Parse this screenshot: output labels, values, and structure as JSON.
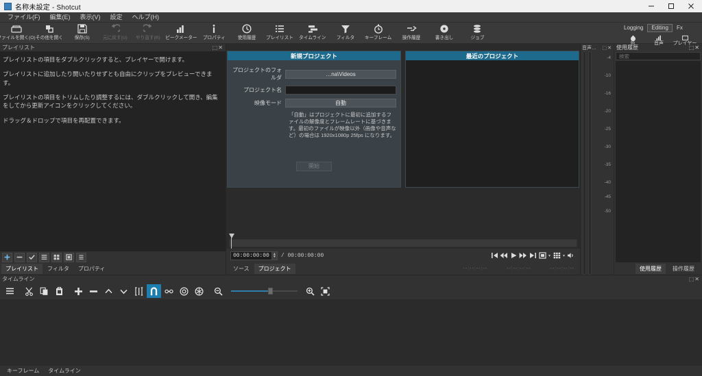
{
  "window": {
    "title": "名称未設定 - Shotcut",
    "minimize": "−",
    "maximize": "▢",
    "close": "✕"
  },
  "menubar": {
    "items": [
      {
        "label": "ファイル(F)"
      },
      {
        "label": "編集(E)"
      },
      {
        "label": "表示(V)"
      },
      {
        "label": "設定"
      },
      {
        "label": "ヘルプ(H)"
      }
    ]
  },
  "toolbar": {
    "items": [
      {
        "label": "ファイルを開く(O)",
        "icon": "open-file-icon",
        "disabled": false
      },
      {
        "label": "その他を開く",
        "icon": "open-other-icon",
        "disabled": false
      },
      {
        "label": "保存(S)",
        "icon": "save-icon",
        "disabled": false
      },
      {
        "label": "元に戻す(U)",
        "icon": "undo-icon",
        "disabled": true
      },
      {
        "label": "やり直す(R)",
        "icon": "redo-icon",
        "disabled": true
      },
      {
        "label": "ピークメーター",
        "icon": "peak-meter-icon",
        "disabled": false
      },
      {
        "label": "プロパティ",
        "icon": "properties-icon",
        "disabled": false
      },
      {
        "label": "使用履歴",
        "icon": "recent-icon",
        "disabled": false
      },
      {
        "label": "プレイリスト",
        "icon": "playlist-icon",
        "disabled": false
      },
      {
        "label": "タイムライン",
        "icon": "timeline-icon",
        "disabled": false
      },
      {
        "label": "フィルタ",
        "icon": "filters-icon",
        "disabled": false
      },
      {
        "label": "キーフレーム",
        "icon": "keyframes-icon",
        "disabled": false
      },
      {
        "label": "操作履歴",
        "icon": "history-icon",
        "disabled": false
      },
      {
        "label": "書き出し",
        "icon": "export-icon",
        "disabled": false
      },
      {
        "label": "ジョブ",
        "icon": "jobs-icon",
        "disabled": false
      }
    ],
    "layouts": {
      "logging": "Logging",
      "editing": "Editing",
      "fx": "Fx",
      "color": "色",
      "audio": "音声",
      "player": "プレイヤー"
    }
  },
  "playlist_panel": {
    "title": "プレイリスト",
    "close_glyph": "⬚✕",
    "hints": [
      "プレイリストの項目をダブルクリックすると、プレイヤーで開けます。",
      "プレイリストに追加したり開いたりせずとも自由にクリップをプレビューできます。",
      "プレイリストの項目をトリムしたり調整するには、ダブルクリックして開き、編集をしてから更新アイコンをクリックしてください。",
      "ドラッグ＆ドロップで項目を再配置できます。"
    ],
    "buttons": [
      {
        "name": "add-to-playlist-button",
        "glyph": "✚"
      },
      {
        "name": "remove-from-playlist-button",
        "glyph": "▬"
      },
      {
        "name": "update-playlist-item-button",
        "glyph": "✔"
      },
      {
        "name": "playlist-detail-view-button",
        "glyph": "☰"
      },
      {
        "name": "playlist-tiles-view-button",
        "glyph": "▦"
      },
      {
        "name": "playlist-icons-view-button",
        "glyph": "▣"
      },
      {
        "name": "playlist-menu-button",
        "glyph": "≡"
      }
    ],
    "tabs": [
      {
        "label": "プレイリスト",
        "active": true
      },
      {
        "label": "フィルタ",
        "active": false
      },
      {
        "label": "プロパティ",
        "active": false
      }
    ]
  },
  "start_page": {
    "new_project": {
      "header": "新規プロジェクト",
      "folder_label": "プロジェクトのフォルダ",
      "folder_value": "…na\\Videos",
      "name_label": "プロジェクト名",
      "name_value": "",
      "video_mode_label": "映像モード",
      "video_mode_value": "自動",
      "description": "「自動」はプロジェクトに最初に追加するファイルの解像度とフレームレートに基づきます。最初のファイルが映像以外（画像や音声など）の場合は 1920x1080p 25fps になります。",
      "start_button": "開始"
    },
    "recent_projects": {
      "header": "最近のプロジェクト",
      "items": []
    }
  },
  "player": {
    "current_time": "00:00:00:00",
    "separator": "/",
    "total_time": "00:00:00:00",
    "controls": [
      {
        "name": "skip-to-start-button",
        "glyph": "⏮"
      },
      {
        "name": "quickly-rewind-button",
        "glyph": "⏪"
      },
      {
        "name": "play-button",
        "glyph": "▶"
      },
      {
        "name": "quickly-forward-button",
        "glyph": "⏩"
      },
      {
        "name": "skip-to-next-button",
        "glyph": "⏭"
      },
      {
        "name": "set-in-out-button",
        "glyph": "▣"
      },
      {
        "name": "grid-button",
        "glyph": "▦"
      },
      {
        "name": "volume-button",
        "glyph": "🔊"
      }
    ],
    "in_marker": "--:--:--:--",
    "selected_marker": "--:--:--:--",
    "out_marker": "--:--:--:--",
    "tabs": [
      {
        "label": "ソース",
        "active": false
      },
      {
        "label": "プロジェクト",
        "active": true
      }
    ]
  },
  "audio_meter": {
    "title": "音声…",
    "close_glyph": "⬚✕",
    "scale": [
      "-4",
      "-10",
      "-16",
      "-20",
      "-25",
      "-30",
      "-35",
      "-40",
      "-45",
      "-50"
    ]
  },
  "history_panel": {
    "title": "使用履歴",
    "close_glyph": "⬚✕",
    "search_placeholder": "検索",
    "items": [],
    "tabs": [
      {
        "label": "使用履歴",
        "active": true
      },
      {
        "label": "操作履歴",
        "active": false
      }
    ]
  },
  "timeline": {
    "title": "タイムライン",
    "close_glyph": "⬚✕",
    "buttons": [
      {
        "name": "timeline-menu-button",
        "glyph": "☰",
        "active": false
      },
      {
        "name": "cut-button",
        "glyph": "✂",
        "active": false
      },
      {
        "name": "copy-button",
        "glyph": "⧉",
        "active": false
      },
      {
        "name": "paste-button",
        "glyph": "📋",
        "active": false
      },
      {
        "name": "append-button",
        "glyph": "✚",
        "active": false
      },
      {
        "name": "ripple-delete-button",
        "glyph": "▬",
        "active": false
      },
      {
        "name": "lift-button",
        "glyph": "∧",
        "active": false
      },
      {
        "name": "overwrite-button",
        "glyph": "∨",
        "active": false
      },
      {
        "name": "split-button",
        "glyph": "⌶",
        "active": false
      },
      {
        "name": "snap-button",
        "glyph": "🧲",
        "active": true
      },
      {
        "name": "scrub-while-dragging-button",
        "glyph": "⊷",
        "active": false
      },
      {
        "name": "ripple-button",
        "glyph": "◎",
        "active": false
      },
      {
        "name": "ripple-all-tracks-button",
        "glyph": "✳",
        "active": false
      },
      {
        "name": "zoom-timeline-out-button",
        "glyph": "🔍",
        "active": false
      }
    ],
    "zoom_in_button": "zoom-timeline-in-icon",
    "zoom_fit_button": "zoom-timeline-fit-icon",
    "zoom_value": 50
  },
  "bottom_tabs": [
    {
      "label": "キーフレーム",
      "active": false
    },
    {
      "label": "タイムライン",
      "active": false
    }
  ]
}
